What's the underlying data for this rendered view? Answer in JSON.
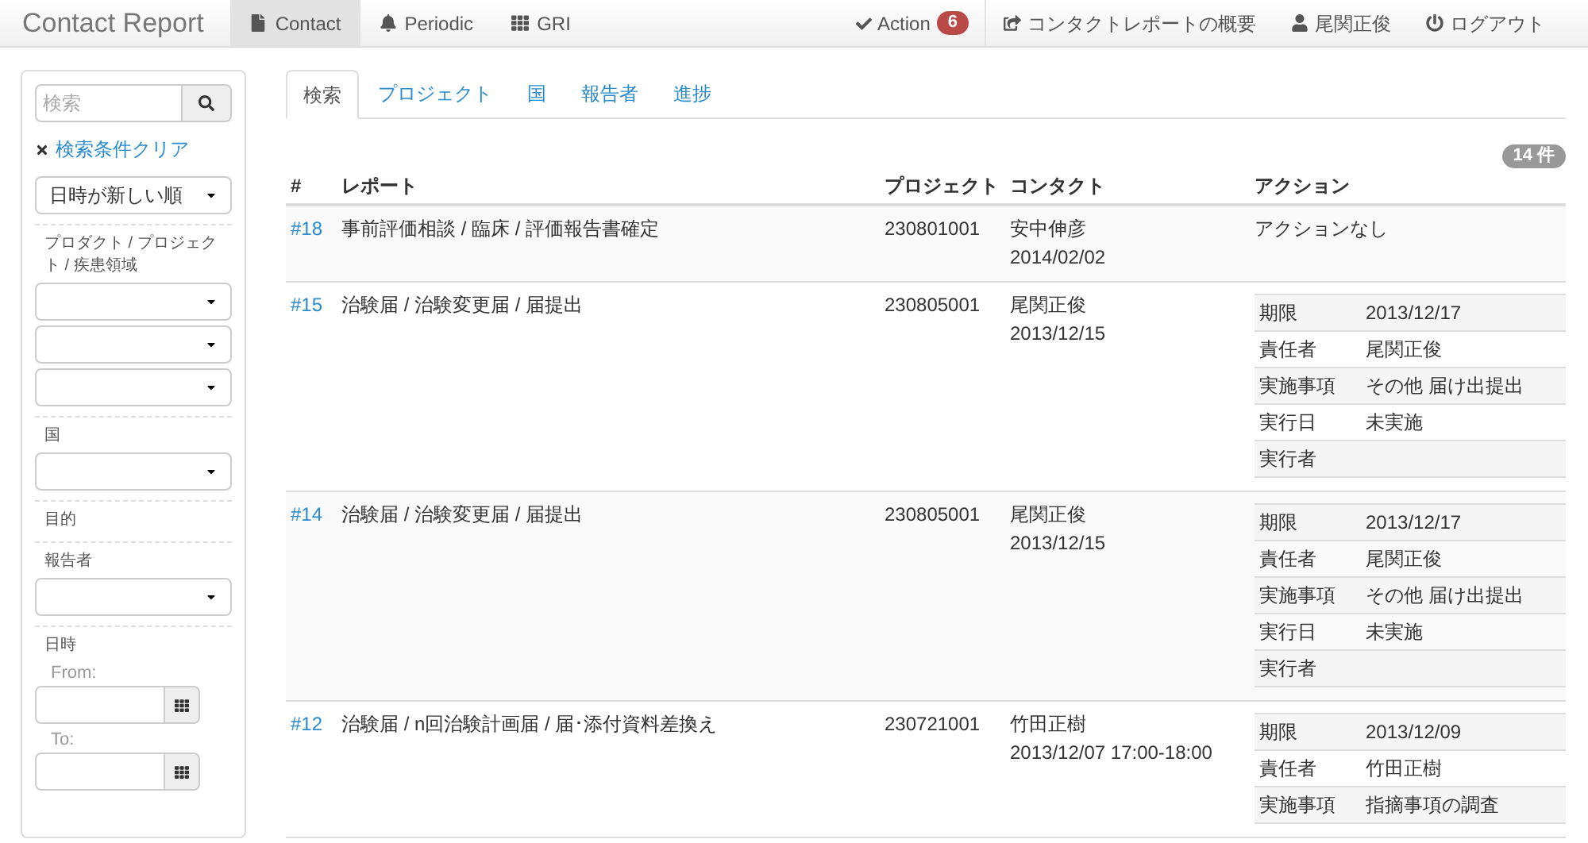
{
  "navbar": {
    "brand": "Contact Report",
    "left_items": [
      {
        "label": "Contact",
        "selected": true
      },
      {
        "label": "Periodic",
        "selected": false
      },
      {
        "label": "GRI",
        "selected": false
      }
    ],
    "action": {
      "label": "Action",
      "badge": "6"
    },
    "right_items": [
      {
        "label": "コンタクトレポートの概要"
      },
      {
        "label": "尾関正俊"
      },
      {
        "label": "ログアウト"
      }
    ]
  },
  "sidebar": {
    "search": {
      "placeholder": "検索"
    },
    "clear_link": "検索条件クリア",
    "sort": {
      "value": "日時が新しい順"
    },
    "sections": [
      {
        "label": "プロダクト / プロジェクト / 疾患領域",
        "fields": [
          {
            "kind": "select"
          },
          {
            "kind": "select"
          },
          {
            "kind": "select"
          }
        ]
      },
      {
        "label": "国",
        "fields": [
          {
            "kind": "select"
          }
        ]
      },
      {
        "label": "目的"
      },
      {
        "label": "報告者",
        "fields": [
          {
            "kind": "select"
          }
        ]
      },
      {
        "label": "日時",
        "fields": [
          {
            "kind": "date",
            "label": "From:"
          },
          {
            "kind": "date",
            "label": "To:"
          }
        ]
      }
    ]
  },
  "tabs": [
    {
      "label": "検索",
      "selected": true
    },
    {
      "label": "プロジェクト",
      "selected": false
    },
    {
      "label": "国",
      "selected": false
    },
    {
      "label": "報告者",
      "selected": false
    },
    {
      "label": "進捗",
      "selected": false
    }
  ],
  "count_badge": "14 件",
  "table": {
    "columns": [
      "#",
      "レポート",
      "プロジェクト",
      "コンタクト",
      "アクション"
    ],
    "rows": [
      {
        "id": "#18",
        "report": "事前評価相談 / 臨床 / 評価報告書確定",
        "project": "230801001",
        "contact_name": "安中伸彦",
        "contact_date": "2014/02/02",
        "no_action": "アクションなし",
        "actions": []
      },
      {
        "id": "#15",
        "report": "治験届 / 治験変更届 / 届提出",
        "project": "230805001",
        "contact_name": "尾関正俊",
        "contact_date": "2013/12/15",
        "actions": [
          {
            "label": "期限",
            "value": "2013/12/17"
          },
          {
            "label": "責任者",
            "value": "尾関正俊"
          },
          {
            "label": "実施事項",
            "value": "その他 届け出提出"
          },
          {
            "label": "実行日",
            "value": "未実施"
          },
          {
            "label": "実行者"
          }
        ]
      },
      {
        "id": "#14",
        "report": "治験届 / 治験変更届 / 届提出",
        "project": "230805001",
        "contact_name": "尾関正俊",
        "contact_date": "2013/12/15",
        "actions": [
          {
            "label": "期限",
            "value": "2013/12/17"
          },
          {
            "label": "責任者",
            "value": "尾関正俊"
          },
          {
            "label": "実施事項",
            "value": "その他 届け出提出"
          },
          {
            "label": "実行日",
            "value": "未実施"
          },
          {
            "label": "実行者"
          }
        ]
      },
      {
        "id": "#12",
        "report": "治験届 / n回治験計画届 / 届･添付資料差換え",
        "project": "230721001",
        "contact_name": "竹田正樹",
        "contact_date": "2013/12/07 17:00-18:00",
        "actions": [
          {
            "label": "期限",
            "value": "2013/12/09"
          },
          {
            "label": "責任者",
            "value": "竹田正樹"
          },
          {
            "label": "実施事項",
            "value": "指摘事項の調査"
          }
        ]
      }
    ]
  }
}
